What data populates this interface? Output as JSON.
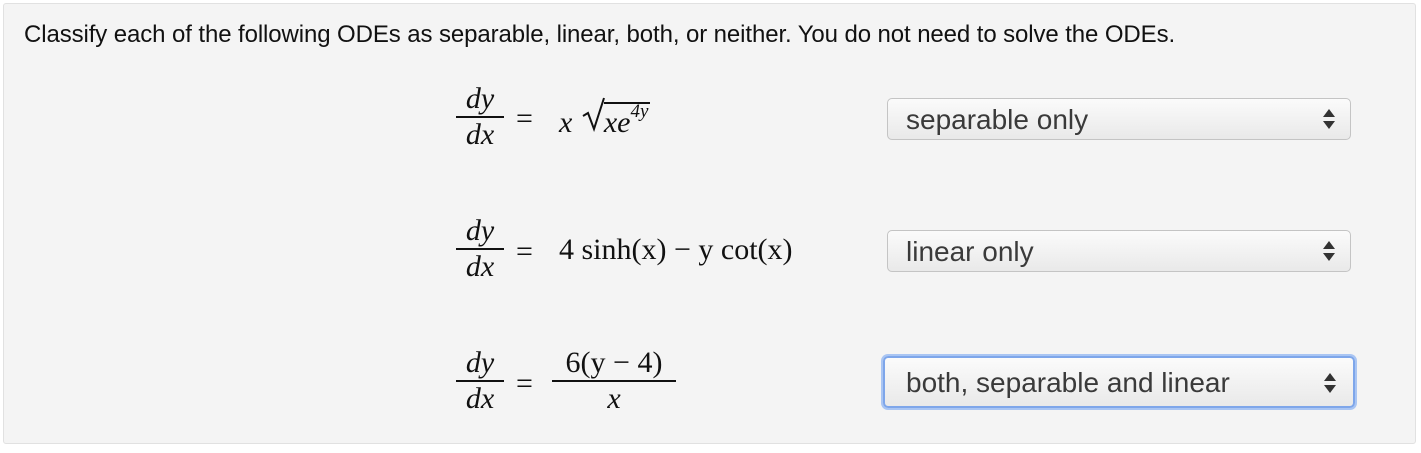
{
  "prompt": "Classify each of the following ODEs as separable, linear, both, or neither. You do not need to solve the ODEs.",
  "odes": [
    {
      "lhs_num": "dy",
      "lhs_den": "dx",
      "equals": "=",
      "rhs_x": "x",
      "rhs_radicand": "xe",
      "rhs_exponent": "4y",
      "answer": "separable only"
    },
    {
      "lhs_num": "dy",
      "lhs_den": "dx",
      "equals": "=",
      "rhs_text": "4 sinh(x) − y cot(x)",
      "answer": "linear only"
    },
    {
      "lhs_num": "dy",
      "lhs_den": "dx",
      "equals": "=",
      "rhs_num": "6(y − 4)",
      "rhs_den": "x",
      "answer": "both, separable and linear"
    }
  ],
  "colors": {
    "focus_ring": "#7ea6ea",
    "panel_bg": "#f4f4f4"
  },
  "icons": {
    "select_arrows": "up-down-chevron-icon"
  }
}
